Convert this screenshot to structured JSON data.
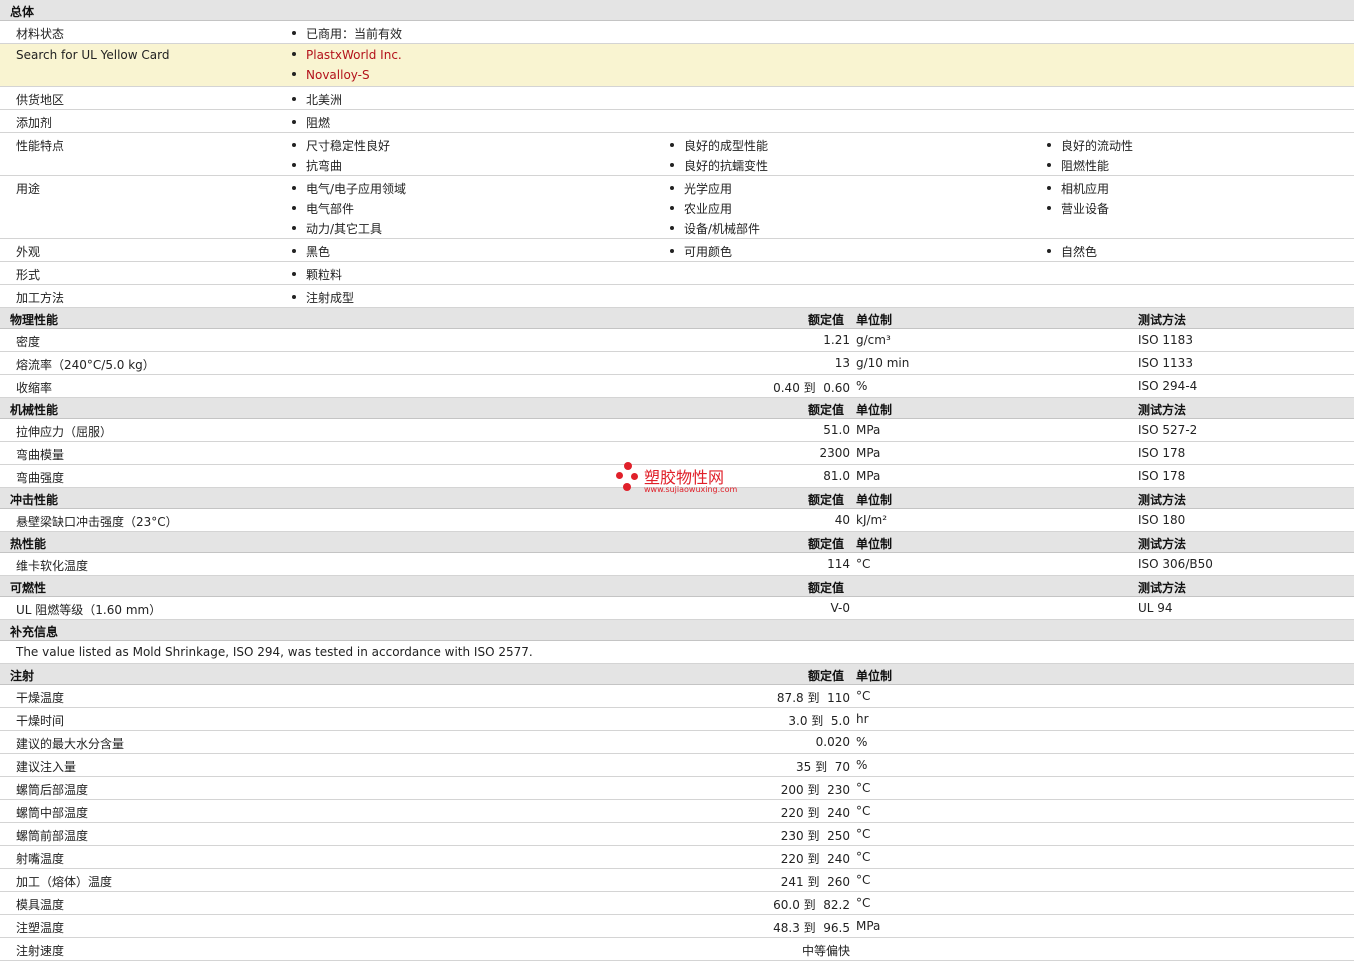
{
  "general": {
    "title": "总体",
    "material_status": {
      "label": "材料状态",
      "value": "已商用：当前有效"
    },
    "ul_card": {
      "label": "Search for UL Yellow Card",
      "links": [
        "PlastxWorld Inc.",
        "Novalloy-S"
      ]
    },
    "region": {
      "label": "供货地区",
      "value": "北美洲"
    },
    "additive": {
      "label": "添加剂",
      "value": "阻燃"
    },
    "features": {
      "label": "性能特点",
      "items": [
        "尺寸稳定性良好",
        "抗弯曲",
        "良好的成型性能",
        "良好的抗蠕变性",
        "良好的流动性",
        "阻燃性能"
      ]
    },
    "uses": {
      "label": "用途",
      "items": [
        "电气/电子应用领域",
        "电气部件",
        "动力/其它工具",
        "光学应用",
        "农业应用",
        "设备/机械部件",
        "相机应用",
        "营业设备"
      ]
    },
    "appearance": {
      "label": "外观",
      "items": [
        "黑色",
        "可用颜色",
        "自然色"
      ]
    },
    "form": {
      "label": "形式",
      "value": "颗粒料"
    },
    "processing": {
      "label": "加工方法",
      "value": "注射成型"
    }
  },
  "col_headers": {
    "nominal": "额定值",
    "unit": "单位制",
    "test": "测试方法"
  },
  "physical": {
    "title": "物理性能",
    "rows": [
      {
        "label": "密度",
        "value": "1.21",
        "unit": "g/cm³",
        "test": "ISO 1183"
      },
      {
        "label": "熔流率（240°C/5.0 kg）",
        "value": "13",
        "unit": "g/10 min",
        "test": "ISO 1133"
      },
      {
        "label": "收缩率",
        "value": "0.40 到  0.60",
        "unit": "%",
        "test": "ISO 294-4"
      }
    ]
  },
  "mechanical": {
    "title": "机械性能",
    "rows": [
      {
        "label": "拉伸应力（屈服）",
        "value": "51.0",
        "unit": "MPa",
        "test": "ISO 527-2"
      },
      {
        "label": "弯曲模量",
        "value": "2300",
        "unit": "MPa",
        "test": "ISO 178"
      },
      {
        "label": "弯曲强度",
        "value": "81.0",
        "unit": "MPa",
        "test": "ISO 178"
      }
    ]
  },
  "impact": {
    "title": "冲击性能",
    "rows": [
      {
        "label": "悬壁梁缺口冲击强度（23°C）",
        "value": "40",
        "unit": "kJ/m²",
        "test": "ISO 180"
      }
    ]
  },
  "thermal": {
    "title": "热性能",
    "rows": [
      {
        "label": "维卡软化温度",
        "value": "114",
        "unit": "°C",
        "test": "ISO 306/B50"
      }
    ]
  },
  "flammability": {
    "title": "可燃性",
    "rows": [
      {
        "label": "UL 阻燃等级（1.60 mm）",
        "value": "V-0",
        "unit": "",
        "test": "UL 94"
      }
    ]
  },
  "supplement": {
    "title": "补充信息",
    "note": "The value listed as Mold Shrinkage, ISO 294, was tested in accordance with ISO 2577."
  },
  "injection": {
    "title": "注射",
    "rows": [
      {
        "label": "干燥温度",
        "value": "87.8 到  110",
        "unit": "°C"
      },
      {
        "label": "干燥时间",
        "value": "3.0 到  5.0",
        "unit": "hr"
      },
      {
        "label": "建议的最大水分含量",
        "value": "0.020",
        "unit": "%"
      },
      {
        "label": "建议注入量",
        "value": "35 到  70",
        "unit": "%"
      },
      {
        "label": "螺筒后部温度",
        "value": "200 到  230",
        "unit": "°C"
      },
      {
        "label": "螺筒中部温度",
        "value": "220 到  240",
        "unit": "°C"
      },
      {
        "label": "螺筒前部温度",
        "value": "230 到  250",
        "unit": "°C"
      },
      {
        "label": "射嘴温度",
        "value": "220 到  240",
        "unit": "°C"
      },
      {
        "label": "加工（熔体）温度",
        "value": "241 到  260",
        "unit": "°C"
      },
      {
        "label": "模具温度",
        "value": "60.0 到  82.2",
        "unit": "°C"
      },
      {
        "label": "注塑温度",
        "value": "48.3 到  96.5",
        "unit": "MPa"
      },
      {
        "label": "注射速度",
        "value": "中等偏快",
        "unit": ""
      }
    ]
  },
  "watermark": {
    "title": "塑胶物性网",
    "url": "www.sujiaowuxing.com",
    "color": "#e0202a"
  },
  "colors": {
    "section_bg": "#e4e4e4",
    "highlight_bg": "#f9f4d1",
    "link": "#b3121b"
  }
}
